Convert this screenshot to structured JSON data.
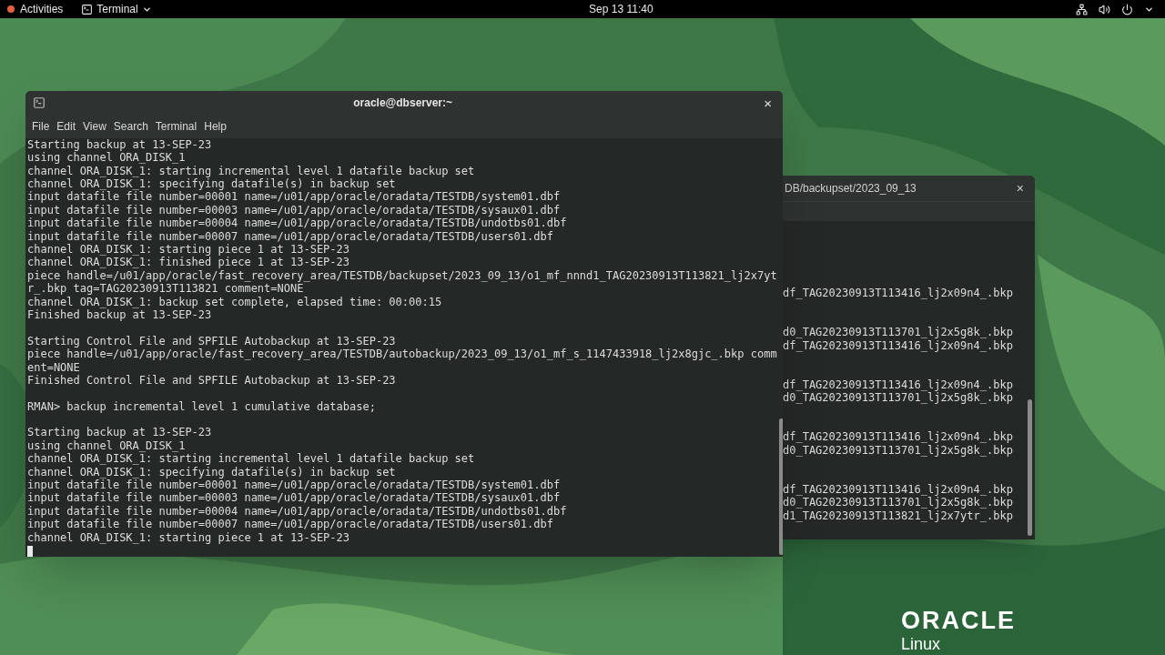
{
  "top_bar": {
    "activities": "Activities",
    "app_menu": "Terminal",
    "clock": "Sep 13 11:40"
  },
  "back_window": {
    "title": "DB/backupset/2023_09_13",
    "close": "×",
    "groups": [
      [
        "df_TAG20230913T113416_lj2x09n4_.bkp"
      ],
      [
        "d0_TAG20230913T113701_lj2x5g8k_.bkp",
        "df_TAG20230913T113416_lj2x09n4_.bkp"
      ],
      [
        "df_TAG20230913T113416_lj2x09n4_.bkp",
        "d0_TAG20230913T113701_lj2x5g8k_.bkp"
      ],
      [
        "df_TAG20230913T113416_lj2x09n4_.bkp",
        "d0_TAG20230913T113701_lj2x5g8k_.bkp"
      ],
      [
        "df_TAG20230913T113416_lj2x09n4_.bkp",
        "d0_TAG20230913T113701_lj2x5g8k_.bkp",
        "d1_TAG20230913T113821_lj2x7ytr_.bkp"
      ]
    ]
  },
  "terminal": {
    "title": "oracle@dbserver:~",
    "close": "×",
    "menu": [
      "File",
      "Edit",
      "View",
      "Search",
      "Terminal",
      "Help"
    ],
    "blocks": [
      [
        "Starting backup at 13-SEP-23",
        "using channel ORA_DISK_1",
        "channel ORA_DISK_1: starting incremental level 1 datafile backup set",
        "channel ORA_DISK_1: specifying datafile(s) in backup set",
        "input datafile file number=00001 name=/u01/app/oracle/oradata/TESTDB/system01.dbf",
        "input datafile file number=00003 name=/u01/app/oracle/oradata/TESTDB/sysaux01.dbf",
        "input datafile file number=00004 name=/u01/app/oracle/oradata/TESTDB/undotbs01.dbf",
        "input datafile file number=00007 name=/u01/app/oracle/oradata/TESTDB/users01.dbf",
        "channel ORA_DISK_1: starting piece 1 at 13-SEP-23",
        "channel ORA_DISK_1: finished piece 1 at 13-SEP-23",
        "piece handle=/u01/app/oracle/fast_recovery_area/TESTDB/backupset/2023_09_13/o1_mf_nnnd1_TAG20230913T113821_lj2x7yt",
        "r_.bkp tag=TAG20230913T113821 comment=NONE",
        "channel ORA_DISK_1: backup set complete, elapsed time: 00:00:15",
        "Finished backup at 13-SEP-23"
      ],
      [
        "Starting Control File and SPFILE Autobackup at 13-SEP-23",
        "piece handle=/u01/app/oracle/fast_recovery_area/TESTDB/autobackup/2023_09_13/o1_mf_s_1147433918_lj2x8gjc_.bkp comm",
        "ent=NONE",
        "Finished Control File and SPFILE Autobackup at 13-SEP-23"
      ],
      [
        "RMAN> backup incremental level 1 cumulative database;"
      ],
      [
        "Starting backup at 13-SEP-23",
        "using channel ORA_DISK_1",
        "channel ORA_DISK_1: starting incremental level 1 datafile backup set",
        "channel ORA_DISK_1: specifying datafile(s) in backup set",
        "input datafile file number=00001 name=/u01/app/oracle/oradata/TESTDB/system01.dbf",
        "input datafile file number=00003 name=/u01/app/oracle/oradata/TESTDB/sysaux01.dbf",
        "input datafile file number=00004 name=/u01/app/oracle/oradata/TESTDB/undotbs01.dbf",
        "input datafile file number=00007 name=/u01/app/oracle/oradata/TESTDB/users01.dbf",
        "channel ORA_DISK_1: starting piece 1 at 13-SEP-23"
      ]
    ]
  },
  "logo": {
    "brand": "ORACLE",
    "product": "Linux"
  }
}
